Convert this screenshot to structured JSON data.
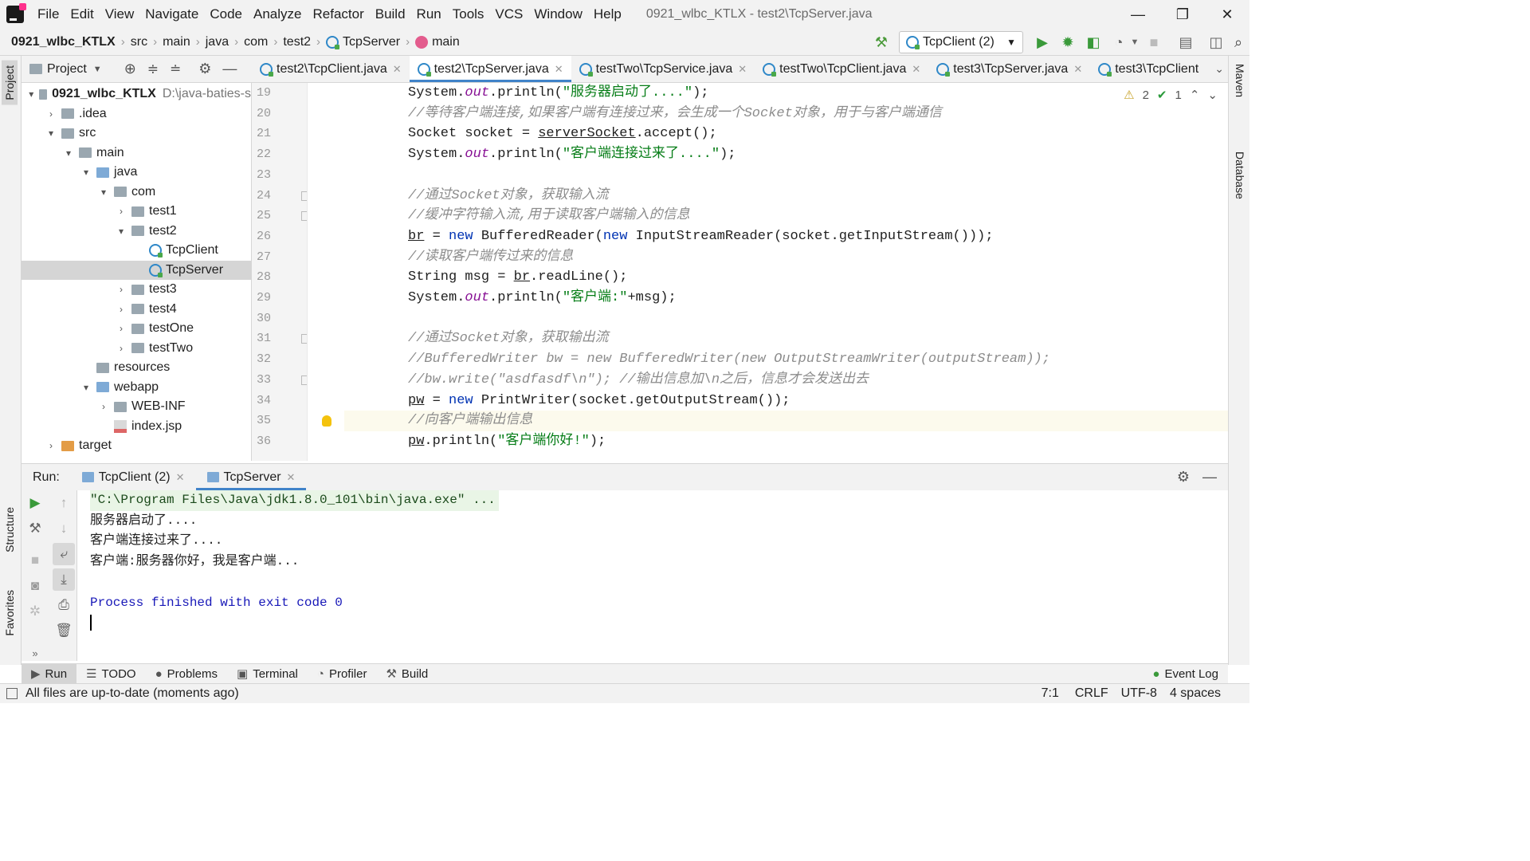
{
  "menu": [
    "File",
    "Edit",
    "View",
    "Navigate",
    "Code",
    "Analyze",
    "Refactor",
    "Build",
    "Run",
    "Tools",
    "VCS",
    "Window",
    "Help"
  ],
  "window_title": "0921_wlbc_KTLX - test2\\TcpServer.java",
  "breadcrumbs": [
    "0921_wlbc_KTLX",
    "src",
    "main",
    "java",
    "com",
    "test2",
    "TcpServer",
    "main"
  ],
  "run_config": "TcpClient (2)",
  "project_panel": {
    "title": "Project"
  },
  "tree": [
    {
      "indent": 0,
      "arrow": "▾",
      "icon": "folder",
      "label": "0921_wlbc_KTLX",
      "extra": "D:\\java-baties-s",
      "bold": true
    },
    {
      "indent": 1,
      "arrow": "›",
      "icon": "folder",
      "label": ".idea"
    },
    {
      "indent": 1,
      "arrow": "▾",
      "icon": "folder",
      "label": "src"
    },
    {
      "indent": 2,
      "arrow": "▾",
      "icon": "folder",
      "label": "main"
    },
    {
      "indent": 3,
      "arrow": "▾",
      "icon": "folder-blue",
      "label": "java"
    },
    {
      "indent": 4,
      "arrow": "▾",
      "icon": "folder",
      "label": "com"
    },
    {
      "indent": 5,
      "arrow": "›",
      "icon": "folder",
      "label": "test1"
    },
    {
      "indent": 5,
      "arrow": "▾",
      "icon": "folder",
      "label": "test2"
    },
    {
      "indent": 6,
      "arrow": "",
      "icon": "class",
      "label": "TcpClient"
    },
    {
      "indent": 6,
      "arrow": "",
      "icon": "class",
      "label": "TcpServer",
      "selected": true
    },
    {
      "indent": 5,
      "arrow": "›",
      "icon": "folder",
      "label": "test3"
    },
    {
      "indent": 5,
      "arrow": "›",
      "icon": "folder",
      "label": "test4"
    },
    {
      "indent": 5,
      "arrow": "›",
      "icon": "folder",
      "label": "testOne"
    },
    {
      "indent": 5,
      "arrow": "›",
      "icon": "folder",
      "label": "testTwo"
    },
    {
      "indent": 3,
      "arrow": "",
      "icon": "folder",
      "label": "resources"
    },
    {
      "indent": 3,
      "arrow": "▾",
      "icon": "folder-blue",
      "label": "webapp"
    },
    {
      "indent": 4,
      "arrow": "›",
      "icon": "folder",
      "label": "WEB-INF"
    },
    {
      "indent": 4,
      "arrow": "",
      "icon": "jsp",
      "label": "index.jsp"
    },
    {
      "indent": 1,
      "arrow": "›",
      "icon": "folder-orange",
      "label": "target"
    }
  ],
  "editor_tabs": [
    {
      "label": "test2\\TcpClient.java"
    },
    {
      "label": "test2\\TcpServer.java",
      "active": true
    },
    {
      "label": "testTwo\\TcpService.java"
    },
    {
      "label": "testTwo\\TcpClient.java"
    },
    {
      "label": "test3\\TcpServer.java"
    },
    {
      "label": "test3\\TcpClient"
    }
  ],
  "inspection": {
    "warnings": "2",
    "ok": "1"
  },
  "code_lines": [
    {
      "n": "19",
      "html": "System.<span class=\"fi\">out</span>.println(<span class=\"st\">\"服务器启动了....\"</span>);"
    },
    {
      "n": "20",
      "html": "<span class=\"cm\">//等待客户端连接,如果客户端有连接过来，会生成一个Socket对象，用于与客户端通信</span>"
    },
    {
      "n": "21",
      "html": "Socket socket = <span class=\"ul\">serverSocket</span>.accept();"
    },
    {
      "n": "22",
      "html": "System.<span class=\"fi\">out</span>.println(<span class=\"st\">\"客户端连接过来了....\"</span>);"
    },
    {
      "n": "23",
      "html": ""
    },
    {
      "n": "24",
      "html": "<span class=\"cm\">//通过Socket对象，获取输入流</span>"
    },
    {
      "n": "25",
      "html": "<span class=\"cm\">//缓冲字符输入流,用于读取客户端输入的信息</span>"
    },
    {
      "n": "26",
      "html": "<span class=\"ul\">br</span> = <span class=\"kw\">new</span> BufferedReader(<span class=\"kw\">new</span> InputStreamReader(socket.getInputStream()));"
    },
    {
      "n": "27",
      "html": "<span class=\"cm\">//读取客户端传过来的信息</span>"
    },
    {
      "n": "28",
      "html": "String msg = <span class=\"ul\">br</span>.readLine();"
    },
    {
      "n": "29",
      "html": "System.<span class=\"fi\">out</span>.println(<span class=\"st\">\"客户端:\"</span>+msg);"
    },
    {
      "n": "30",
      "html": ""
    },
    {
      "n": "31",
      "html": "<span class=\"cm\">//通过Socket对象，获取输出流</span>"
    },
    {
      "n": "32",
      "html": "<span class=\"cm\">//BufferedWriter bw = new BufferedWriter(new OutputStreamWriter(outputStream));</span>"
    },
    {
      "n": "33",
      "html": "<span class=\"cm\">//bw.write(\"asdfasdf\\n\"); //输出信息加\\n之后，信息才会发送出去</span>"
    },
    {
      "n": "34",
      "html": "<span class=\"ul\">pw</span> = <span class=\"kw\">new</span> PrintWriter(socket.getOutputStream());"
    },
    {
      "n": "35",
      "html": "<span class=\"cm\">//向客户端输出信息</span>",
      "highlight": true
    },
    {
      "n": "36",
      "html": "<span class=\"ul\">pw</span>.println(<span class=\"st\">\"客户端你好!\"</span>);"
    }
  ],
  "run_panel": {
    "label": "Run:",
    "tabs": [
      {
        "label": "TcpClient (2)"
      },
      {
        "label": "TcpServer",
        "active": true
      }
    ]
  },
  "console": [
    {
      "text": "\"C:\\Program Files\\Java\\jdk1.8.0_101\\bin\\java.exe\" ...",
      "kind": "cmd"
    },
    {
      "text": "服务器启动了....",
      "kind": ""
    },
    {
      "text": "客户端连接过来了....",
      "kind": ""
    },
    {
      "text": "客户端:服务器你好，我是客户端...",
      "kind": ""
    },
    {
      "text": "",
      "kind": ""
    },
    {
      "text": "Process finished with exit code 0",
      "kind": "fin"
    }
  ],
  "tool_windows": [
    {
      "label": "Run",
      "icon": "▶",
      "active": true
    },
    {
      "label": "TODO",
      "icon": "☰"
    },
    {
      "label": "Problems",
      "icon": "●"
    },
    {
      "label": "Terminal",
      "icon": "▣"
    },
    {
      "label": "Profiler",
      "icon": "◔"
    },
    {
      "label": "Build",
      "icon": "⚒"
    }
  ],
  "event_log": "Event Log",
  "status": {
    "message": "All files are up-to-date (moments ago)",
    "position": "7:1",
    "line_sep": "CRLF",
    "encoding": "UTF-8",
    "indent": "4 spaces"
  },
  "side_labels": {
    "project": "Project",
    "structure": "Structure",
    "favorites": "Favorites",
    "maven": "Maven",
    "database": "Database"
  }
}
